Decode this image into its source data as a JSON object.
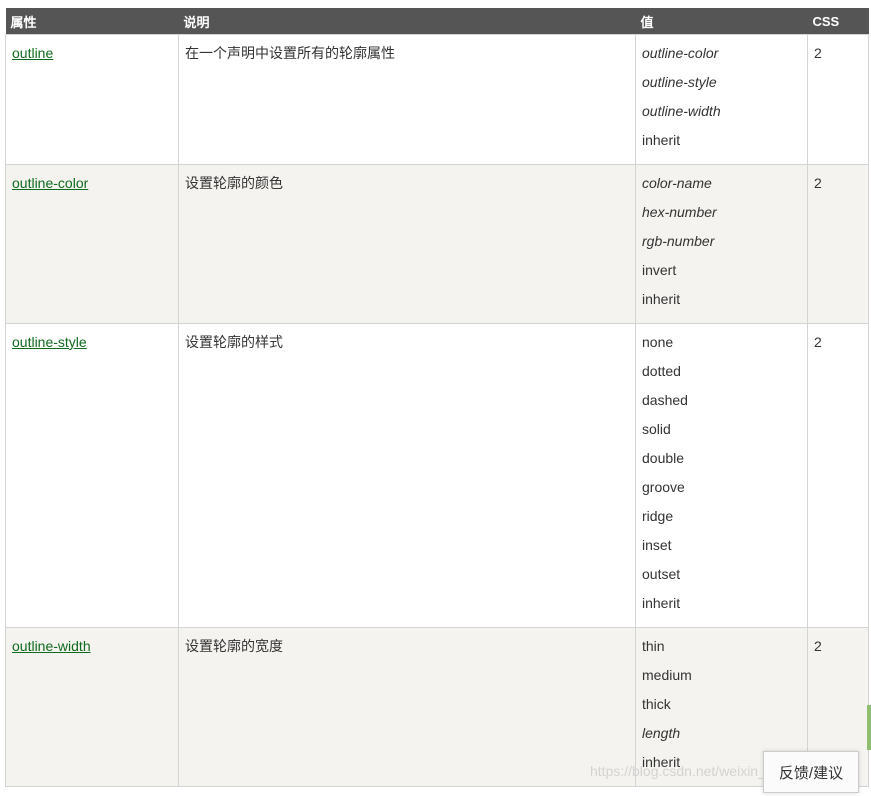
{
  "headers": {
    "property": "属性",
    "description": "说明",
    "values": "值",
    "css": "CSS"
  },
  "rows": [
    {
      "property": "outline",
      "description": "在一个声明中设置所有的轮廓属性",
      "values": [
        {
          "text": "outline-color",
          "italic": true
        },
        {
          "text": "outline-style",
          "italic": true
        },
        {
          "text": "outline-width",
          "italic": true
        },
        {
          "text": "inherit",
          "italic": false
        }
      ],
      "css": "2"
    },
    {
      "property": "outline-color",
      "description": "设置轮廓的颜色",
      "values": [
        {
          "text": "color-name",
          "italic": true
        },
        {
          "text": "hex-number",
          "italic": true
        },
        {
          "text": "rgb-number",
          "italic": true
        },
        {
          "text": "invert",
          "italic": false
        },
        {
          "text": "inherit",
          "italic": false
        }
      ],
      "css": "2"
    },
    {
      "property": "outline-style",
      "description": "设置轮廓的样式",
      "values": [
        {
          "text": "none",
          "italic": false
        },
        {
          "text": "dotted",
          "italic": false
        },
        {
          "text": "dashed",
          "italic": false
        },
        {
          "text": "solid",
          "italic": false
        },
        {
          "text": "double",
          "italic": false
        },
        {
          "text": "groove",
          "italic": false
        },
        {
          "text": "ridge",
          "italic": false
        },
        {
          "text": "inset",
          "italic": false
        },
        {
          "text": "outset",
          "italic": false
        },
        {
          "text": "inherit",
          "italic": false
        }
      ],
      "css": "2"
    },
    {
      "property": "outline-width",
      "description": "设置轮廓的宽度",
      "values": [
        {
          "text": "thin",
          "italic": false
        },
        {
          "text": "medium",
          "italic": false
        },
        {
          "text": "thick",
          "italic": false
        },
        {
          "text": "length",
          "italic": true
        },
        {
          "text": "inherit",
          "italic": false
        }
      ],
      "css": "2"
    }
  ],
  "feedback_label": "反馈/建议",
  "watermark": "https://blog.csdn.net/weixin_4...5",
  "colors": {
    "header_bg": "#555555",
    "link": "#0f6b1f",
    "alt_row": "#f4f3ef"
  }
}
